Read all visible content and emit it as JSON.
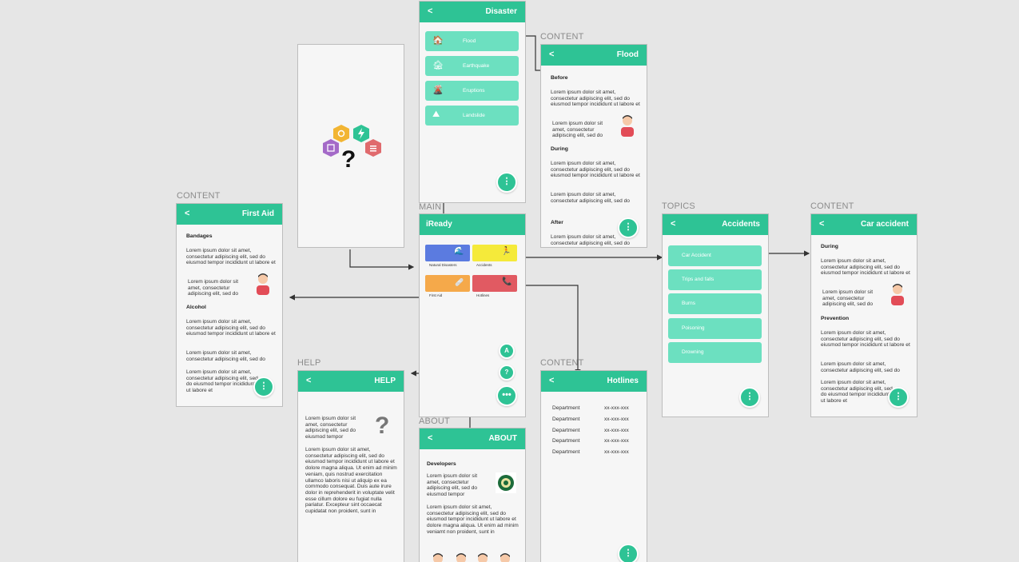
{
  "labels": {
    "content": "CONTENT",
    "main": "MAIN",
    "topics": "TOPICS",
    "help": "HELP",
    "about": "ABOUT"
  },
  "disaster": {
    "back": "<",
    "title": "Disaster",
    "items": [
      "Flood",
      "Earthquake",
      "Eruptions",
      "Landslide"
    ]
  },
  "flood": {
    "back": "<",
    "title": "Flood",
    "before": "Before",
    "during": "During",
    "after": "After",
    "p1": "Lorem ipsum dolor sit amet, consectetur adipiscing elit, sed do eiusmod tempor incididunt ut labore et",
    "p2": "Lorem ipsum dolor sit amet, consectetur adipiscing elit, sed do",
    "p3": "Lorem ipsum dolor sit amet, consectetur adipiscing elit, sed do eiusmod tempor incididunt ut labore et",
    "p4": "Lorem ipsum dolor sit amet, consectetur adipiscing elit, sed do",
    "p5": "Lorem ipsum dolor sit amet, consectetur adipiscing elit, sed do"
  },
  "firstaid": {
    "back": "<",
    "title": "First Aid",
    "bandages": "Bandages",
    "alcohol": "Alcohol",
    "p1": "Lorem ipsum dolor sit amet, consectetur adipiscing elit, sed do eiusmod tempor incididunt ut labore et",
    "p2": "Lorem ipsum dolor sit amet, consectetur adipiscing elit, sed do",
    "p3": "Lorem ipsum dolor sit amet, consectetur adipiscing elit, sed do eiusmod tempor incididunt ut labore et",
    "p4": "Lorem ipsum dolor sit amet, consectetur adipiscing elit, sed do",
    "p5": "Lorem ipsum dolor sit amet, consectetur adipiscing elit, sed do eiusmod tempor incididunt ut labore et"
  },
  "main": {
    "title": "iReady",
    "tiles": [
      "Natural Disasters",
      "Accidents",
      "First Aid",
      "Hotlines"
    ],
    "fab_a": "A",
    "fab_q": "?",
    "fab_more": "•••"
  },
  "accidents": {
    "back": "<",
    "title": "Accidents",
    "items": [
      "Car Accident",
      "Trips and falls",
      "Burns",
      "Poisoning",
      "Drowning"
    ]
  },
  "caraccident": {
    "back": "<",
    "title": "Car accident",
    "during": "During",
    "prevention": "Prevention",
    "p1": "Lorem ipsum dolor sit amet, consectetur adipiscing elit, sed do eiusmod tempor incididunt ut labore et",
    "p2": "Lorem ipsum dolor sit amet, consectetur adipiscing elit, sed do",
    "p3": "Lorem ipsum dolor sit amet, consectetur adipiscing elit, sed do eiusmod tempor incididunt ut labore et",
    "p4": "Lorem ipsum dolor sit amet, consectetur adipiscing elit, sed do",
    "p5": "Lorem ipsum dolor sit amet, consectetur adipiscing elit, sed do eiusmod tempor incididunt ut labore et"
  },
  "help": {
    "back": "<",
    "title": "HELP",
    "p1": "Lorem ipsum dolor sit amet, consectetur adipiscing elit, sed do eiusmod tempor",
    "p2": "Lorem ipsum dolor sit amet, consectetur adipiscing elit, sed do eiusmod tempor incididunt ut labore et dolore magna aliqua. Ut enim ad minim veniam, quis nostrud exercitation ullamco laboris nisi ut aliquip ex ea commodo consequat. Duis aute irure dolor in reprehenderit in voluptate velit esse cillum dolore eu fugiat nulla pariatur. Excepteur sint occaecat cupidatat non proident, sunt in"
  },
  "about": {
    "back": "<",
    "title": "ABOUT",
    "developers": "Developers",
    "p1": "Lorem ipsum dolor sit amet, consectetur adipiscing elit, sed do eiusmod tempor",
    "p2": "Lorem ipsum dolor sit amet, consectetur adipiscing elit, sed do eiusmod tempor incididunt ut labore et dolore magna aliqua. Ut enim ad minim veniamt non proident, sunt in"
  },
  "hotlines": {
    "back": "<",
    "title": "Hotlines",
    "rows": [
      {
        "dept": "Department",
        "num": "xx-xxx-xxx"
      },
      {
        "dept": "Department",
        "num": "xx-xxx-xxx"
      },
      {
        "dept": "Department",
        "num": "xx-xxx-xxx"
      },
      {
        "dept": "Department",
        "num": "xx-xxx-xxx"
      },
      {
        "dept": "Department",
        "num": "xx-xxx-xxx"
      }
    ]
  },
  "colors": {
    "accent": "#2ec395",
    "pill": "#6ce0c0",
    "tile_blue": "#5b7be0",
    "tile_yellow": "#f5ea3a",
    "tile_orange": "#f5a94a",
    "tile_red": "#e15a62"
  }
}
